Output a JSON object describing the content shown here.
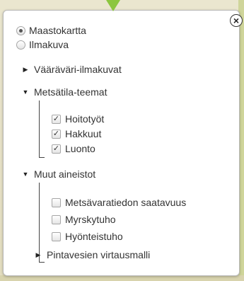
{
  "base_layers": [
    {
      "label": "Maastokartta",
      "selected": true
    },
    {
      "label": "Ilmakuva",
      "selected": false
    }
  ],
  "groups": [
    {
      "label": "Vääräväri-ilmakuvat",
      "expanded": false
    },
    {
      "label": "Metsätila-teemat",
      "expanded": true,
      "items": [
        {
          "label": "Hoitotyöt",
          "checked": true
        },
        {
          "label": "Hakkuut",
          "checked": true
        },
        {
          "label": "Luonto",
          "checked": true
        }
      ]
    },
    {
      "label": "Muut aineistot",
      "expanded": true,
      "items": [
        {
          "label": "Metsävaratiedon saatavuus",
          "checked": false
        },
        {
          "label": "Myrskytuho",
          "checked": false
        },
        {
          "label": "Hyönteistuho",
          "checked": false
        }
      ],
      "subgroups": [
        {
          "label": "Pintavesien virtausmalli",
          "expanded": false
        }
      ]
    }
  ],
  "icons": {
    "close": "×",
    "collapsed": "▶",
    "expanded": "▼",
    "checkmark": "✓"
  },
  "colors": {
    "pointer_accent": "#8cc63f",
    "panel_background": "#ffffff"
  }
}
